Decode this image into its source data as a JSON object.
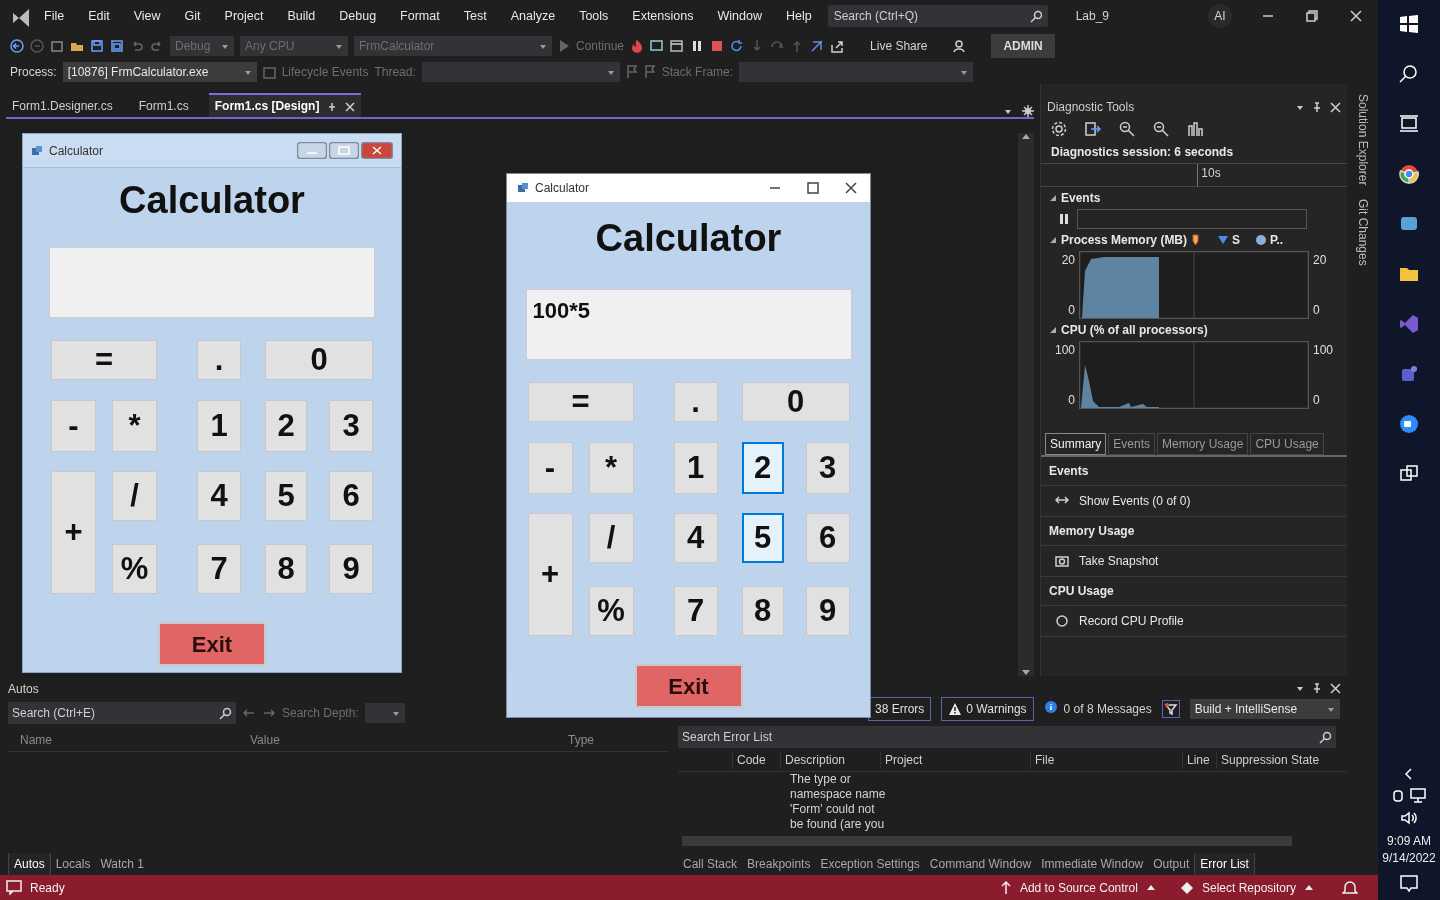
{
  "menu": {
    "items": [
      "File",
      "Edit",
      "View",
      "Git",
      "Project",
      "Build",
      "Debug",
      "Format",
      "Test",
      "Analyze",
      "Tools",
      "Extensions",
      "Window",
      "Help"
    ],
    "search": {
      "placeholder": "Search (Ctrl+Q)"
    },
    "solution": "Lab_9",
    "user_initials": "AI"
  },
  "toolbar": {
    "configuration": "Debug",
    "platform": "Any CPU",
    "startup": "FrmCalculator",
    "continue": "Continue",
    "live_share": "Live Share",
    "account": "ADMIN"
  },
  "debug_location": {
    "process_label": "Process:",
    "process": "[10876] FrmCalculator.exe",
    "lifecycle": "Lifecycle Events",
    "thread_label": "Thread:",
    "stack_frame_label": "Stack Frame:"
  },
  "doc_tabs": [
    {
      "label": "Form1.Designer.cs",
      "selected": false
    },
    {
      "label": "Form1.cs",
      "selected": false
    },
    {
      "label": "Form1.cs [Design]",
      "selected": true
    }
  ],
  "design_form": {
    "title": "Calculator",
    "heading": "Calculator",
    "buttons": [
      {
        "label": "="
      },
      {
        "label": "."
      },
      {
        "label": "0"
      },
      {
        "label": "-"
      },
      {
        "label": "*"
      },
      {
        "label": "1"
      },
      {
        "label": "2"
      },
      {
        "label": "3"
      },
      {
        "label": "+"
      },
      {
        "label": "/"
      },
      {
        "label": "4"
      },
      {
        "label": "5"
      },
      {
        "label": "6"
      },
      {
        "label": "%"
      },
      {
        "label": "7"
      },
      {
        "label": "8"
      },
      {
        "label": "9"
      }
    ],
    "exit": "Exit"
  },
  "running_app": {
    "title": "Calculator",
    "heading": "Calculator",
    "display": "100*5",
    "buttons": [
      {
        "label": "=",
        "highlighted": false
      },
      {
        "label": ".",
        "highlighted": false
      },
      {
        "label": "0",
        "highlighted": false
      },
      {
        "label": "-",
        "highlighted": false
      },
      {
        "label": "*",
        "highlighted": false
      },
      {
        "label": "1",
        "highlighted": false
      },
      {
        "label": "2",
        "highlighted": true
      },
      {
        "label": "3",
        "highlighted": false
      },
      {
        "label": "+",
        "highlighted": false
      },
      {
        "label": "/",
        "highlighted": false
      },
      {
        "label": "4",
        "highlighted": false
      },
      {
        "label": "5",
        "highlighted": true
      },
      {
        "label": "6",
        "highlighted": false
      },
      {
        "label": "%",
        "highlighted": false
      },
      {
        "label": "7",
        "highlighted": false
      },
      {
        "label": "8",
        "highlighted": false
      },
      {
        "label": "9",
        "highlighted": false
      }
    ],
    "exit": "Exit"
  },
  "diagnostics": {
    "title": "Diagnostic Tools",
    "session": "Diagnostics session: 6 seconds",
    "timeline_label": "10s",
    "events_title": "Events",
    "memory": {
      "title": "Process Memory (MB)",
      "legend": [
        "S",
        "P.."
      ],
      "left_labels": [
        "20",
        "0"
      ],
      "right_labels": [
        "20",
        "0"
      ]
    },
    "cpu": {
      "title": "CPU (% of all processors)",
      "left_labels": [
        "100",
        "0"
      ],
      "right_labels": [
        "100",
        "0"
      ]
    },
    "tabs": [
      {
        "label": "Summary",
        "selected": true
      },
      {
        "label": "Events",
        "selected": false
      },
      {
        "label": "Memory Usage",
        "selected": false
      },
      {
        "label": "CPU Usage",
        "selected": false
      }
    ],
    "sections": [
      {
        "title": "Events",
        "action": "Show Events (0 of 0)"
      },
      {
        "title": "Memory Usage",
        "action": "Take Snapshot"
      },
      {
        "title": "CPU Usage",
        "action": "Record CPU Profile"
      }
    ]
  },
  "side_tabs": [
    "Solution Explorer",
    "Git Changes"
  ],
  "autos": {
    "title": "Autos",
    "search": {
      "placeholder": "Search (Ctrl+E)"
    },
    "depth_label": "Search Depth:",
    "columns": [
      "Name",
      "Value",
      "Type"
    ],
    "tabs": [
      {
        "label": "Autos",
        "selected": true
      },
      {
        "label": "Locals",
        "selected": false
      },
      {
        "label": "Watch 1",
        "selected": false
      }
    ]
  },
  "error_list": {
    "errors": "38 Errors",
    "warnings": "0 Warnings",
    "messages": "0 of 8 Messages",
    "source": "Build + IntelliSense",
    "search": {
      "placeholder": "Search Error List"
    },
    "columns": [
      "Code",
      "Description",
      "Project",
      "File",
      "Line",
      "Suppression State"
    ],
    "rows": [
      {
        "description": "The type or namespace name 'Form' could not be found (are you"
      }
    ],
    "tabs": [
      {
        "label": "Call Stack",
        "selected": false
      },
      {
        "label": "Breakpoints",
        "selected": false
      },
      {
        "label": "Exception Settings",
        "selected": false
      },
      {
        "label": "Command Window",
        "selected": false
      },
      {
        "label": "Immediate Window",
        "selected": false
      },
      {
        "label": "Output",
        "selected": false
      },
      {
        "label": "Error List",
        "selected": true
      }
    ]
  },
  "status_bar": {
    "state": "Ready",
    "source_control": "Add to Source Control",
    "repository": "Select Repository"
  },
  "taskbar": {
    "time": "9:09 AM",
    "date": "9/14/2022"
  }
}
